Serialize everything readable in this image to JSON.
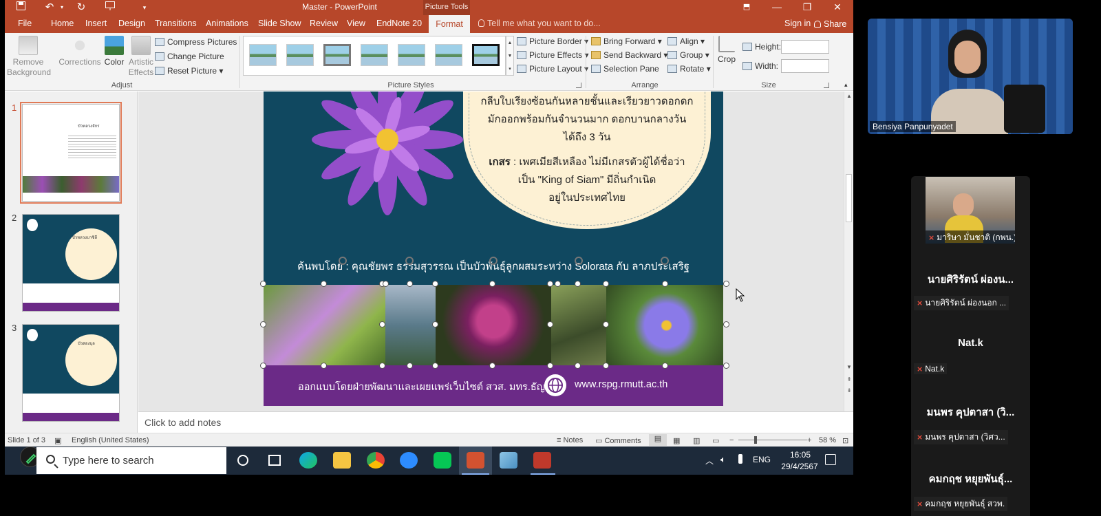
{
  "window": {
    "title": "Master - PowerPoint",
    "context_tab": "Picture Tools"
  },
  "tabs": [
    "File",
    "Home",
    "Insert",
    "Design",
    "Transitions",
    "Animations",
    "Slide Show",
    "Review",
    "View",
    "EndNote 20",
    "Format"
  ],
  "tell_me": "Tell me what you want to do...",
  "signin": "Sign in",
  "share": "Share",
  "ribbon": {
    "adjust": {
      "remove_background": "Remove Background",
      "corrections": "Corrections",
      "color": "Color",
      "artistic_effects": "Artistic Effects",
      "compress": "Compress Pictures",
      "change": "Change Picture",
      "reset": "Reset Picture",
      "label": "Adjust"
    },
    "picture_styles": {
      "border": "Picture Border",
      "effects": "Picture Effects",
      "layout": "Picture Layout",
      "label": "Picture Styles"
    },
    "arrange": {
      "bring_forward": "Bring Forward",
      "send_backward": "Send Backward",
      "selection_pane": "Selection Pane",
      "align": "Align",
      "group": "Group",
      "rotate": "Rotate",
      "label": "Arrange"
    },
    "size": {
      "crop": "Crop",
      "height": "Height:",
      "width": "Width:",
      "label": "Size"
    }
  },
  "thumbnails": [
    {
      "num": "1",
      "title": "บัวหลวงจักร"
    },
    {
      "num": "2",
      "title": "บัวหลวงบาซิลี"
    },
    {
      "num": "3",
      "title": "บัวสองบุล"
    }
  ],
  "slide": {
    "circle_lines": [
      "กลีบใบเรียงซ้อนกันหลายชั้นและเรียวยาวดอกดก",
      "มักออกพร้อมกันจำนวนมาก ดอกบานกลางวัน",
      "ได้ถึง 3 วัน"
    ],
    "kesorn_label": "เกสร",
    "kesorn_line1": ": เพศเมียสีเหลือง ไม่มีเกสรตัวผู้ได้ชื่อว่า",
    "kesorn_line2": "เป็น \"King of Siam\" มีถิ่นกำเนิด",
    "kesorn_line3": "อยู่ในประเทศไทย",
    "caption": "ค้นพบโดย : คุณชัยพร ธรรมสุวรรณ เป็นบัวพันธุ์ลูกผสมระหว่าง Solorata กับ ลาภประเสริฐ",
    "footer_text": "ออกแบบโดยฝ่ายพัฒนาและเผยแพร่เว็บไซต์ สวส. มทร.ธัญบุรี",
    "footer_url": "www.rspg.rmutt.ac.th"
  },
  "notes_placeholder": "Click to add notes",
  "status": {
    "slide": "Slide 1 of 3",
    "language": "English (United States)",
    "notes": "Notes",
    "comments": "Comments",
    "zoom": "58 %"
  },
  "taskbar": {
    "search": "Type here to search",
    "lang": "ENG",
    "time": "16:05",
    "date": "29/4/2567"
  },
  "zoom": {
    "main_name": "Bensiya Panpunyadet",
    "participants": [
      {
        "tag": "มาริษา มั่นชาติ (กพน.)"
      },
      {
        "big": "นายศิริรัตน์ ผ่องน...",
        "tag": "นายศิริรัตน์ ผ่องนอก ..."
      },
      {
        "big": "Nat.k",
        "tag": "Nat.k"
      },
      {
        "big": "มนพร คุปตาสา (วิ...",
        "tag": "มนพร คุปตาสา (วิศว..."
      },
      {
        "big": "คมกฤช หยุยพันธุ์...",
        "tag": "คมกฤช หยุยพันธุ์ สวพ."
      }
    ]
  },
  "colors": {
    "ppt_accent": "#b7472a",
    "slide_bg": "#104860",
    "circle": "#fdf1d4",
    "footer_band": "#6b2a87"
  }
}
